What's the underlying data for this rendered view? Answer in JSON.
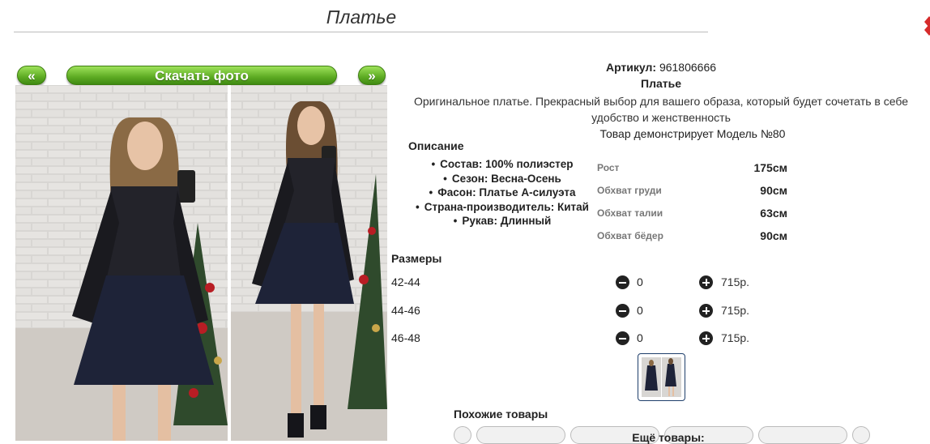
{
  "page": {
    "title": "Платье"
  },
  "gallery": {
    "prev_label": "«",
    "download_label": "Скачать фото",
    "next_label": "»"
  },
  "product": {
    "article_label": "Артикул:",
    "article_value": "961806666",
    "name": "Платье",
    "description": "Оригинальное платье. Прекрасный выбор для вашего образа, который будет сочетать в себе удобство и женственность",
    "model_note": "Товар демонстрирует Модель №80"
  },
  "details": {
    "heading": "Описание",
    "items": [
      "Состав: 100% полиэстер",
      "Сезон: Весна-Осень",
      "Фасон: Платье А-силуэта",
      "Страна-производитель: Китай",
      "Рукав: Длинный"
    ]
  },
  "measurements": [
    {
      "label": "Рост",
      "value": "175см"
    },
    {
      "label": "Обхват груди",
      "value": "90см"
    },
    {
      "label": "Обхват талии",
      "value": "63см"
    },
    {
      "label": "Обхват бёдер",
      "value": "90см"
    }
  ],
  "sizes": {
    "heading": "Размеры",
    "rows": [
      {
        "size": "42-44",
        "qty": "0",
        "price": "715р."
      },
      {
        "size": "44-46",
        "qty": "0",
        "price": "715р."
      },
      {
        "size": "46-48",
        "qty": "0",
        "price": "715р."
      }
    ]
  },
  "footer": {
    "similar_label": "Похожие товары",
    "more_label": "Ещё товары:"
  },
  "colors": {
    "button_green": "#5dab23",
    "dress_navy": "#1e2338",
    "thumb_border": "#1f3f6b"
  }
}
